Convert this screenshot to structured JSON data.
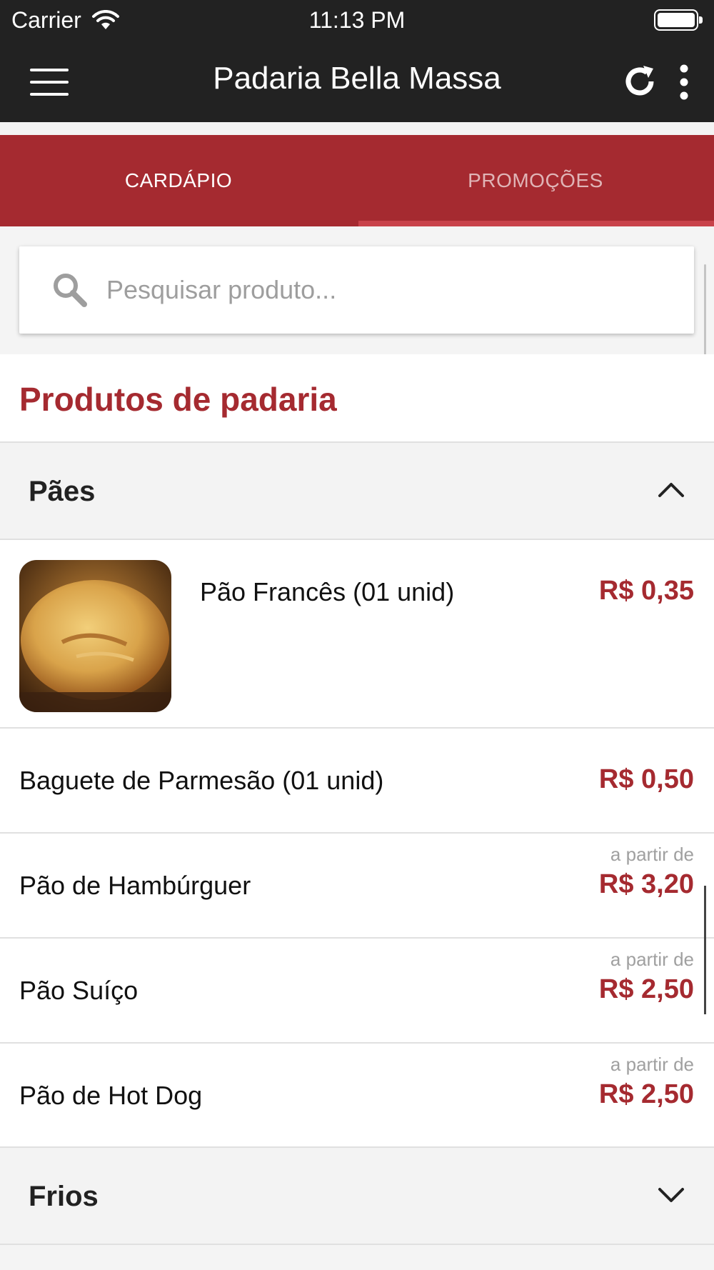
{
  "status_bar": {
    "carrier": "Carrier",
    "time": "11:13 PM"
  },
  "app_bar": {
    "title": "Padaria Bella Massa",
    "menu_icon": "hamburger-menu-icon",
    "refresh_icon": "refresh-icon",
    "more_icon": "more-vertical-icon"
  },
  "tabs": [
    {
      "label": "CARDÁPIO",
      "active": true
    },
    {
      "label": "PROMOÇÕES",
      "active": false
    }
  ],
  "search": {
    "placeholder": "Pesquisar produto...",
    "value": ""
  },
  "section": {
    "title": "Produtos de padaria"
  },
  "groups": [
    {
      "label": "Pães",
      "expanded": true,
      "items": [
        {
          "name": "Pão Francês (01 unid)",
          "price": "R$ 0,35",
          "from_label": "",
          "has_image": true
        },
        {
          "name": "Baguete de Parmesão (01 unid)",
          "price": "R$ 0,50",
          "from_label": ""
        },
        {
          "name": "Pão de Hambúrguer",
          "price": "R$ 3,20",
          "from_label": "a partir de"
        },
        {
          "name": "Pão Suíço",
          "price": "R$ 2,50",
          "from_label": "a partir de"
        },
        {
          "name": "Pão de Hot Dog",
          "price": "R$ 2,50",
          "from_label": "a partir de"
        }
      ]
    },
    {
      "label": "Frios",
      "expanded": false,
      "items": []
    }
  ],
  "colors": {
    "brand_red": "#a52a30",
    "app_bar": "#222222",
    "background": "#f4f4f4"
  }
}
